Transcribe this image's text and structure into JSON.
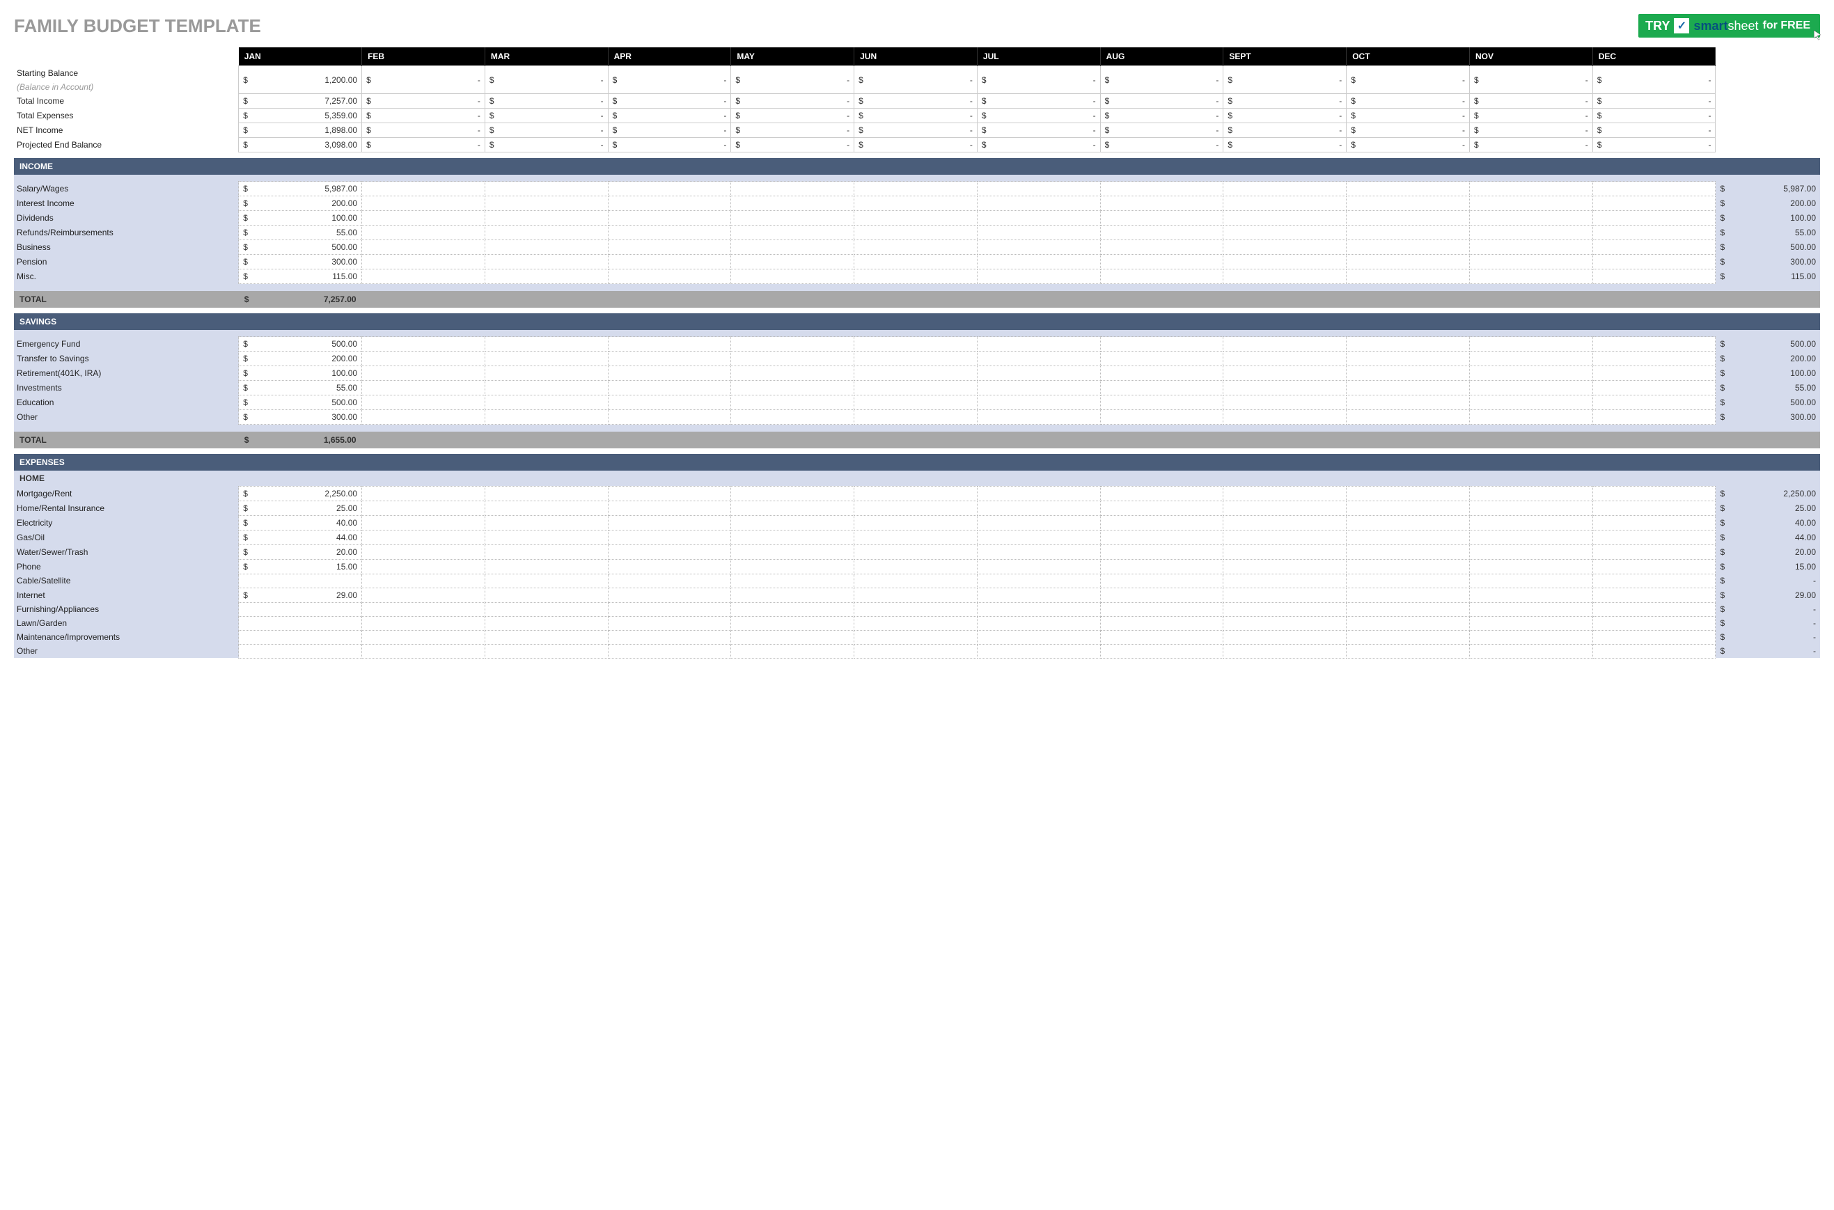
{
  "title": "FAMILY BUDGET TEMPLATE",
  "promo": {
    "try": "TRY",
    "brand1": "smart",
    "brand2": "sheet",
    "free": "for FREE"
  },
  "months": [
    "JAN",
    "FEB",
    "MAR",
    "APR",
    "MAY",
    "JUN",
    "JUL",
    "AUG",
    "SEPT",
    "OCT",
    "NOV",
    "DEC"
  ],
  "summary": [
    {
      "label": "Starting Balance",
      "sublabel": "(Balance in Account)",
      "jan": "1,200.00"
    },
    {
      "label": "Total Income",
      "jan": "7,257.00"
    },
    {
      "label": "Total Expenses",
      "jan": "5,359.00"
    },
    {
      "label": "NET Income",
      "jan": "1,898.00"
    },
    {
      "label": "Projected End Balance",
      "jan": "3,098.00"
    }
  ],
  "income": {
    "heading": "INCOME",
    "rows": [
      {
        "label": "Salary/Wages",
        "jan": "5,987.00",
        "total": "5,987.00"
      },
      {
        "label": "Interest Income",
        "jan": "200.00",
        "total": "200.00"
      },
      {
        "label": "Dividends",
        "jan": "100.00",
        "total": "100.00"
      },
      {
        "label": "Refunds/Reimbursements",
        "jan": "55.00",
        "total": "55.00"
      },
      {
        "label": "Business",
        "jan": "500.00",
        "total": "500.00"
      },
      {
        "label": "Pension",
        "jan": "300.00",
        "total": "300.00"
      },
      {
        "label": "Misc.",
        "jan": "115.00",
        "total": "115.00"
      }
    ],
    "totalLabel": "TOTAL",
    "total": "7,257.00"
  },
  "savings": {
    "heading": "SAVINGS",
    "rows": [
      {
        "label": "Emergency Fund",
        "jan": "500.00",
        "total": "500.00"
      },
      {
        "label": "Transfer to Savings",
        "jan": "200.00",
        "total": "200.00"
      },
      {
        "label": "Retirement(401K, IRA)",
        "jan": "100.00",
        "total": "100.00"
      },
      {
        "label": "Investments",
        "jan": "55.00",
        "total": "55.00"
      },
      {
        "label": "Education",
        "jan": "500.00",
        "total": "500.00"
      },
      {
        "label": "Other",
        "jan": "300.00",
        "total": "300.00"
      }
    ],
    "totalLabel": "TOTAL",
    "total": "1,655.00"
  },
  "expenses": {
    "heading": "EXPENSES",
    "groups": [
      {
        "name": "HOME",
        "rows": [
          {
            "label": "Mortgage/Rent",
            "jan": "2,250.00",
            "total": "2,250.00"
          },
          {
            "label": "Home/Rental Insurance",
            "jan": "25.00",
            "total": "25.00"
          },
          {
            "label": "Electricity",
            "jan": "40.00",
            "total": "40.00"
          },
          {
            "label": "Gas/Oil",
            "jan": "44.00",
            "total": "44.00"
          },
          {
            "label": "Water/Sewer/Trash",
            "jan": "20.00",
            "total": "20.00"
          },
          {
            "label": "Phone",
            "jan": "15.00",
            "total": "15.00"
          },
          {
            "label": "Cable/Satellite",
            "jan": "",
            "total": "-"
          },
          {
            "label": "Internet",
            "jan": "29.00",
            "total": "29.00"
          },
          {
            "label": "Furnishing/Appliances",
            "jan": "",
            "total": "-"
          },
          {
            "label": "Lawn/Garden",
            "jan": "",
            "total": "-"
          },
          {
            "label": "Maintenance/Improvements",
            "jan": "",
            "total": "-"
          },
          {
            "label": "Other",
            "jan": "",
            "total": "-"
          }
        ]
      }
    ]
  }
}
